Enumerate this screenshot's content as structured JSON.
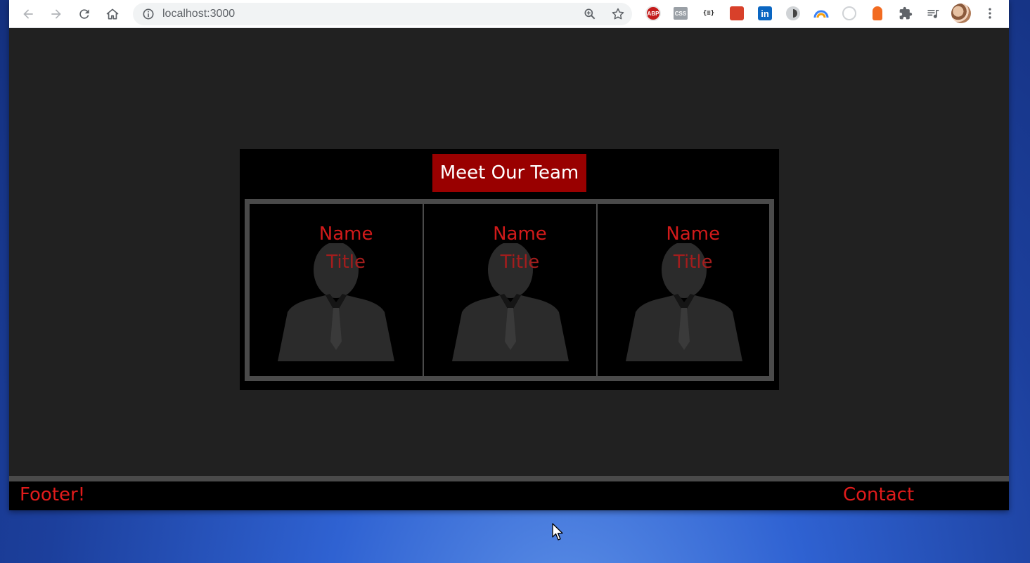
{
  "browser": {
    "url": "localhost:3000",
    "extensions": {
      "adblock_label": "ABP",
      "css_label": "CSS",
      "json_label": "{≡}",
      "linkedin_label": "in"
    }
  },
  "team": {
    "heading": "Meet Our Team",
    "members": [
      {
        "name": "Name",
        "title": "Title"
      },
      {
        "name": "Name",
        "title": "Title"
      },
      {
        "name": "Name",
        "title": "Title"
      }
    ]
  },
  "footer": {
    "left_label": "Footer!",
    "right_label": "Contact"
  },
  "colors": {
    "page_bg": "#212121",
    "card_bg": "#000000",
    "accent": "#990000",
    "text_red": "#d11a1a",
    "border_gray": "#4a4a4a"
  }
}
